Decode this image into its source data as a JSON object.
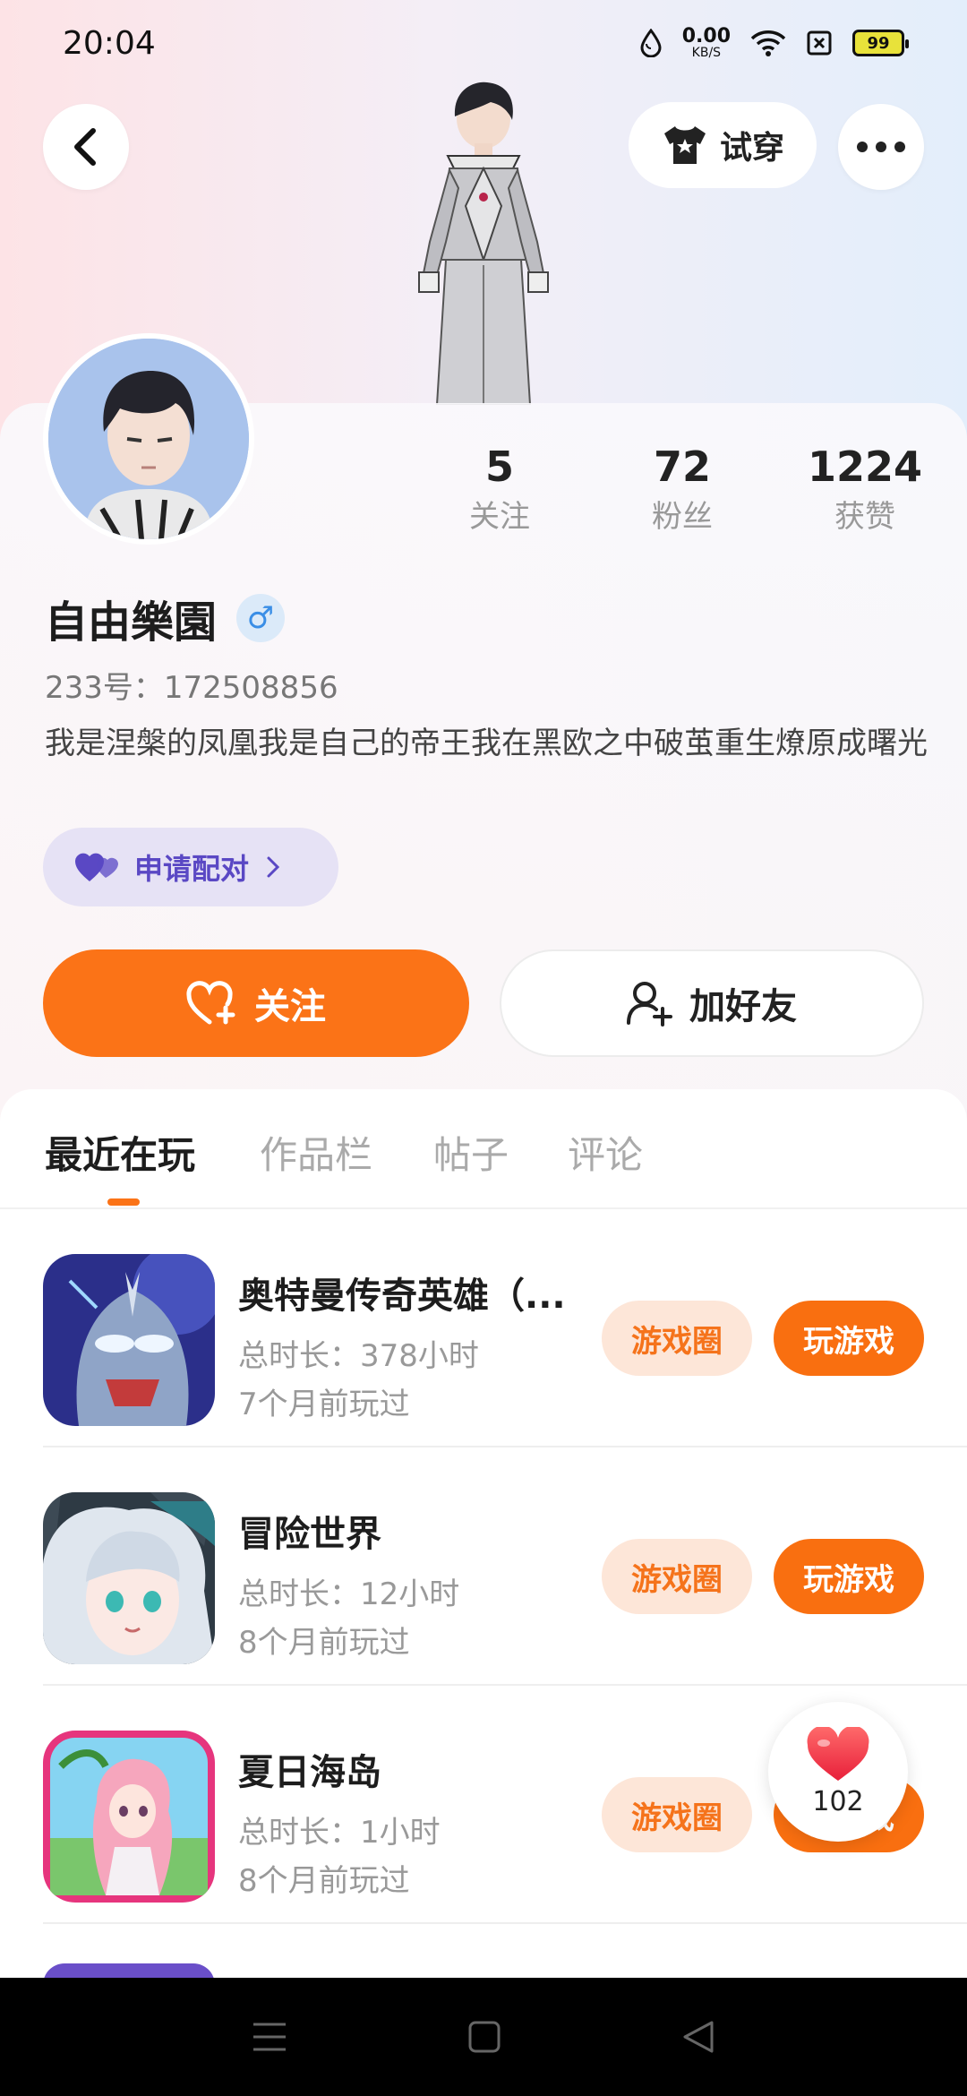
{
  "status_bar": {
    "time": "20:04",
    "net_speed": "0.00",
    "net_unit": "KB/S",
    "battery": "99"
  },
  "header": {
    "tryon_label": "试穿"
  },
  "profile": {
    "stats": [
      {
        "value": "5",
        "label": "关注"
      },
      {
        "value": "72",
        "label": "粉丝"
      },
      {
        "value": "1224",
        "label": "获赞"
      }
    ],
    "name": "自由樂園",
    "gender_symbol": "♂",
    "id_line": "233号：172508856",
    "bio": "我是涅槃的凤凰我是自己的帝王我在黑欧之中破茧重生燎原成曙光",
    "pair_label": "申请配对",
    "follow_label": "关注",
    "add_friend_label": "加好友"
  },
  "tabs": [
    {
      "label": "最近在玩",
      "active": true
    },
    {
      "label": "作品栏",
      "active": false
    },
    {
      "label": "帖子",
      "active": false
    },
    {
      "label": "评论",
      "active": false
    }
  ],
  "games": [
    {
      "title": "奥特曼传奇英雄（...",
      "total": "总时长：378小时",
      "last": "7个月前玩过",
      "circle_label": "游戏圈",
      "play_label": "玩游戏"
    },
    {
      "title": "冒险世界",
      "total": "总时长：12小时",
      "last": "8个月前玩过",
      "circle_label": "游戏圈",
      "play_label": "玩游戏"
    },
    {
      "title": "夏日海岛",
      "total": "总时长：1小时",
      "last": "8个月前玩过",
      "circle_label": "游戏圈",
      "play_label": "玩游戏"
    }
  ],
  "like_float": {
    "count": "102"
  },
  "colors": {
    "accent": "#fb7317",
    "pair_text": "#5a48c4",
    "gender": "#3a8ee6"
  }
}
